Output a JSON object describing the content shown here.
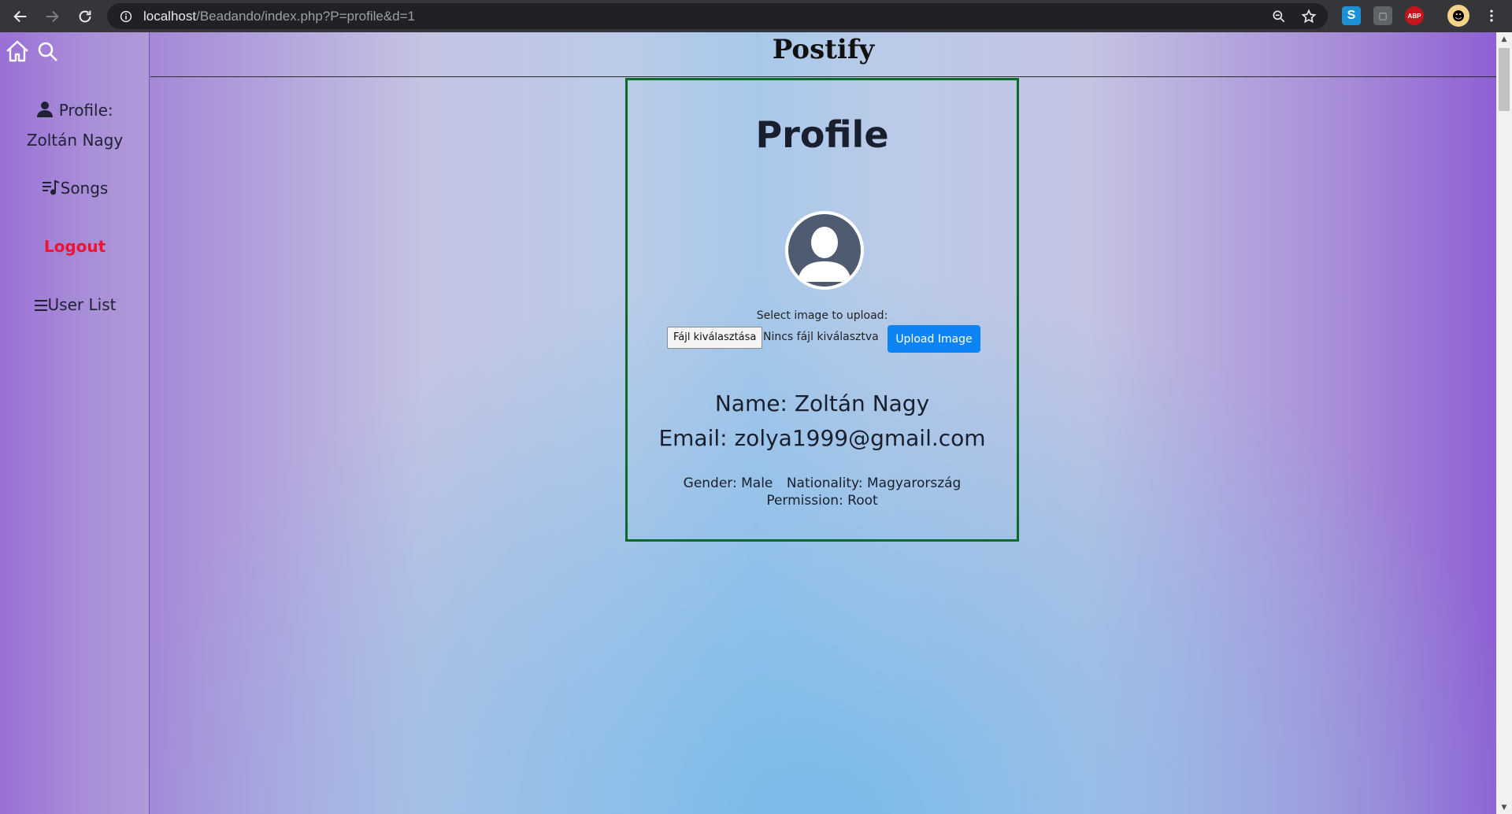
{
  "browser": {
    "url_host": "localhost",
    "url_path": "/Beadando/index.php?P=profile&d=1",
    "extensions": [
      "S",
      "ABP"
    ]
  },
  "sidebar": {
    "profile_label": "Profile:",
    "profile_name": "Zoltán Nagy",
    "songs_label": "Songs",
    "logout_label": "Logout",
    "userlist_label": "User List"
  },
  "header": {
    "brand": "Postify"
  },
  "profile": {
    "title": "Profile",
    "upload_prompt": "Select image to upload:",
    "file_button": "Fájl kiválasztása",
    "file_status": "Nincs fájl kiválasztva",
    "upload_button": "Upload Image",
    "name_label": "Name:",
    "name_value": "Zoltán Nagy",
    "email_label": "Email:",
    "email_value": "zolya1999@gmail.com",
    "gender_label": "Gender:",
    "gender_value": "Male",
    "nationality_label": "Nationality:",
    "nationality_value": "Magyarország",
    "permission_label": "Permission:",
    "permission_value": "Root"
  },
  "colors": {
    "accent_button": "#0d84f5",
    "logout": "#f0122e",
    "card_border": "#0b6b2a"
  }
}
